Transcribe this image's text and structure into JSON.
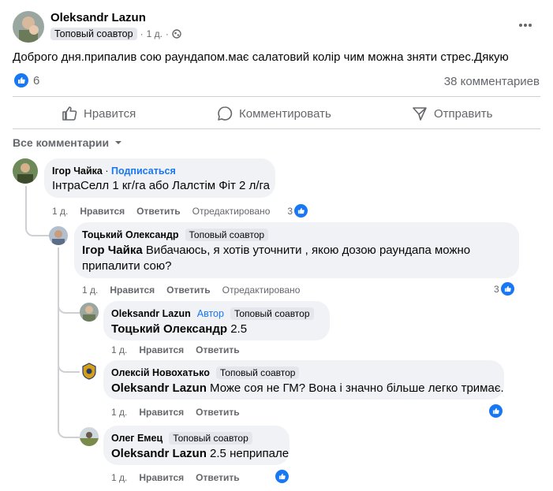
{
  "post": {
    "author": "Oleksandr Lazun",
    "badge": "Топовый соавтор",
    "time": "1 д.",
    "sep": "·",
    "text": "Доброго дня.припалив сою раундапом.має салатовий колір чим можна зняти стрес.Дякую",
    "likes": "6",
    "comments_count": "38 комментариев"
  },
  "actions": {
    "like": "Нравится",
    "comment": "Комментировать",
    "share": "Отправить"
  },
  "filter": {
    "label": "Все комментарии"
  },
  "comments": [
    {
      "author": "Ігор Чайка",
      "follow": "Подписаться",
      "text": "ІнтраСелл 1 кг/га або Лалстім Фіт 2 л/га",
      "time": "1 д.",
      "like": "Нравится",
      "reply": "Ответить",
      "edited": "Отредактировано",
      "reactions": "3"
    },
    {
      "author": "Тоцький Олександр",
      "badge": "Топовый соавтор",
      "mention": "Ігор Чайка",
      "text": "Вибачаюсь, я хотів уточнити , якою дозою раундапа можно припалити сою?",
      "time": "1 д.",
      "like": "Нравится",
      "reply": "Ответить",
      "edited": "Отредактировано",
      "reactions": "3"
    },
    {
      "author": "Oleksandr Lazun",
      "author_tag": "Автор",
      "badge": "Топовый соавтор",
      "mention": "Тоцький Олександр",
      "text": "2.5",
      "time": "1 д.",
      "like": "Нравится",
      "reply": "Ответить"
    },
    {
      "author": "Олексій Новохатько",
      "badge": "Топовый соавтор",
      "mention": "Oleksandr Lazun",
      "text": "Може соя не ГМ? Вона і значно більше легко тримає.",
      "time": "1 д.",
      "like": "Нравится",
      "reply": "Ответить"
    },
    {
      "author": "Олег Емец",
      "badge": "Топовый соавтор",
      "mention": "Oleksandr Lazun",
      "text": "2.5 неприпале",
      "time": "1 д.",
      "like": "Нравится",
      "reply": "Ответить"
    }
  ]
}
